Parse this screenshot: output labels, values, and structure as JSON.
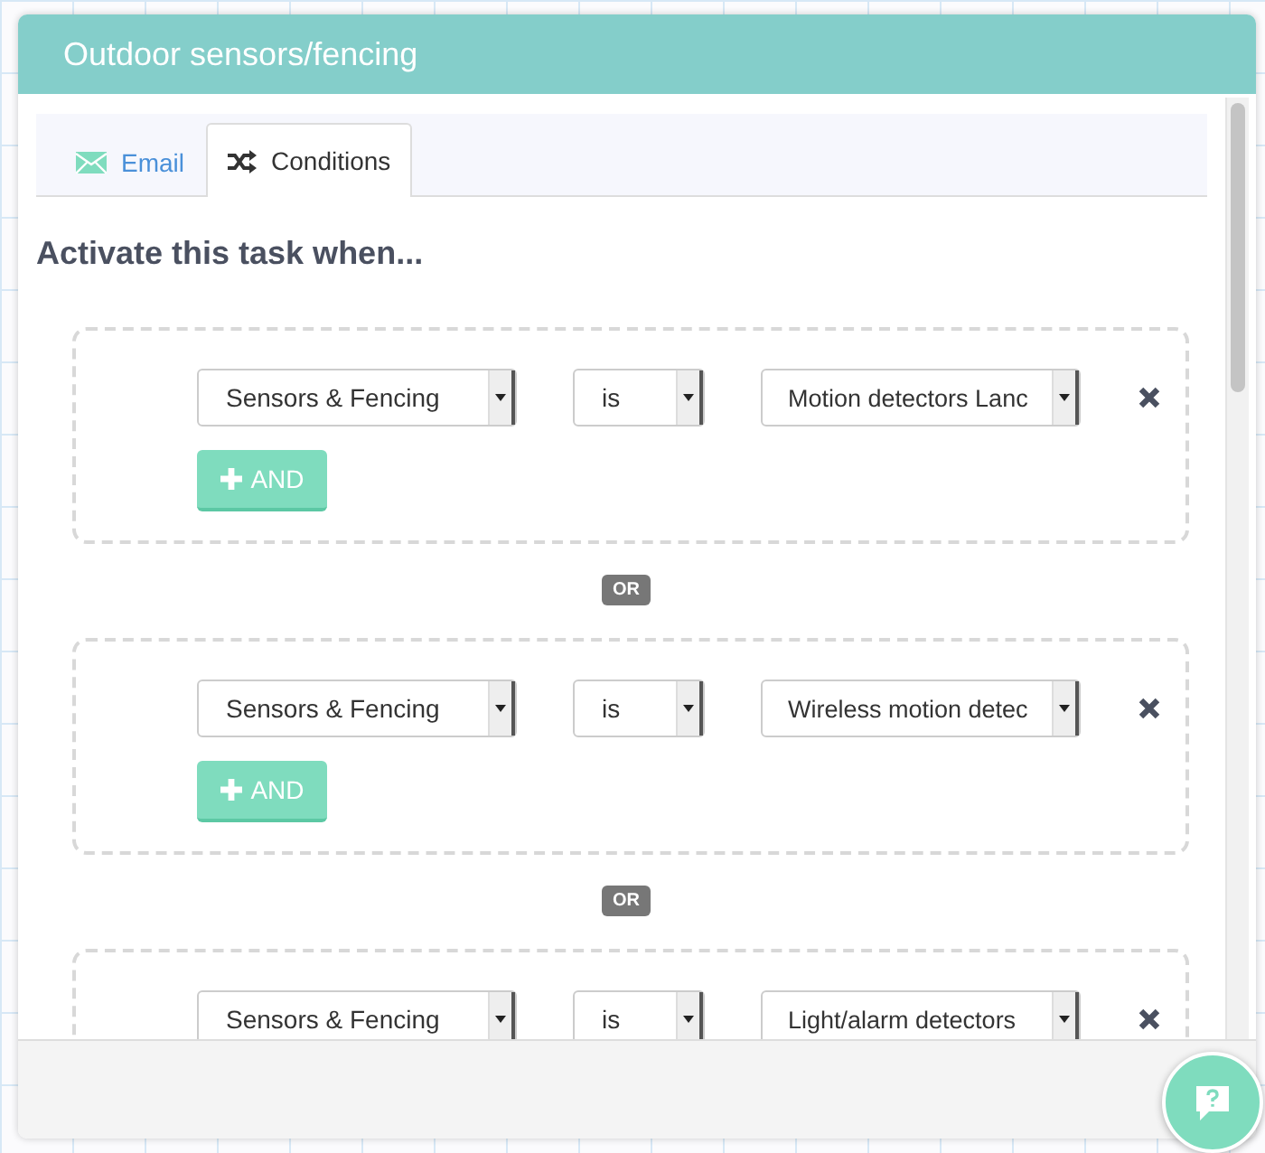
{
  "window": {
    "title": "Outdoor sensors/fencing"
  },
  "tabs": [
    {
      "label": "Email",
      "kind": "email",
      "selected": false
    },
    {
      "label": "Conditions",
      "kind": "conditions",
      "selected": true
    }
  ],
  "heading": "Activate this task when...",
  "condition_groups": [
    {
      "category": "Sensors & Fencing",
      "operator": "is",
      "value": "Motion detectors Lanc",
      "and_button": "AND"
    },
    {
      "separator_before": "OR",
      "category": "Sensors & Fencing",
      "operator": "is",
      "value": "Wireless motion detec",
      "and_button": "AND"
    },
    {
      "separator_before": "OR",
      "category": "Sensors & Fencing",
      "operator": "is",
      "value": "Light/alarm detectors"
    }
  ]
}
